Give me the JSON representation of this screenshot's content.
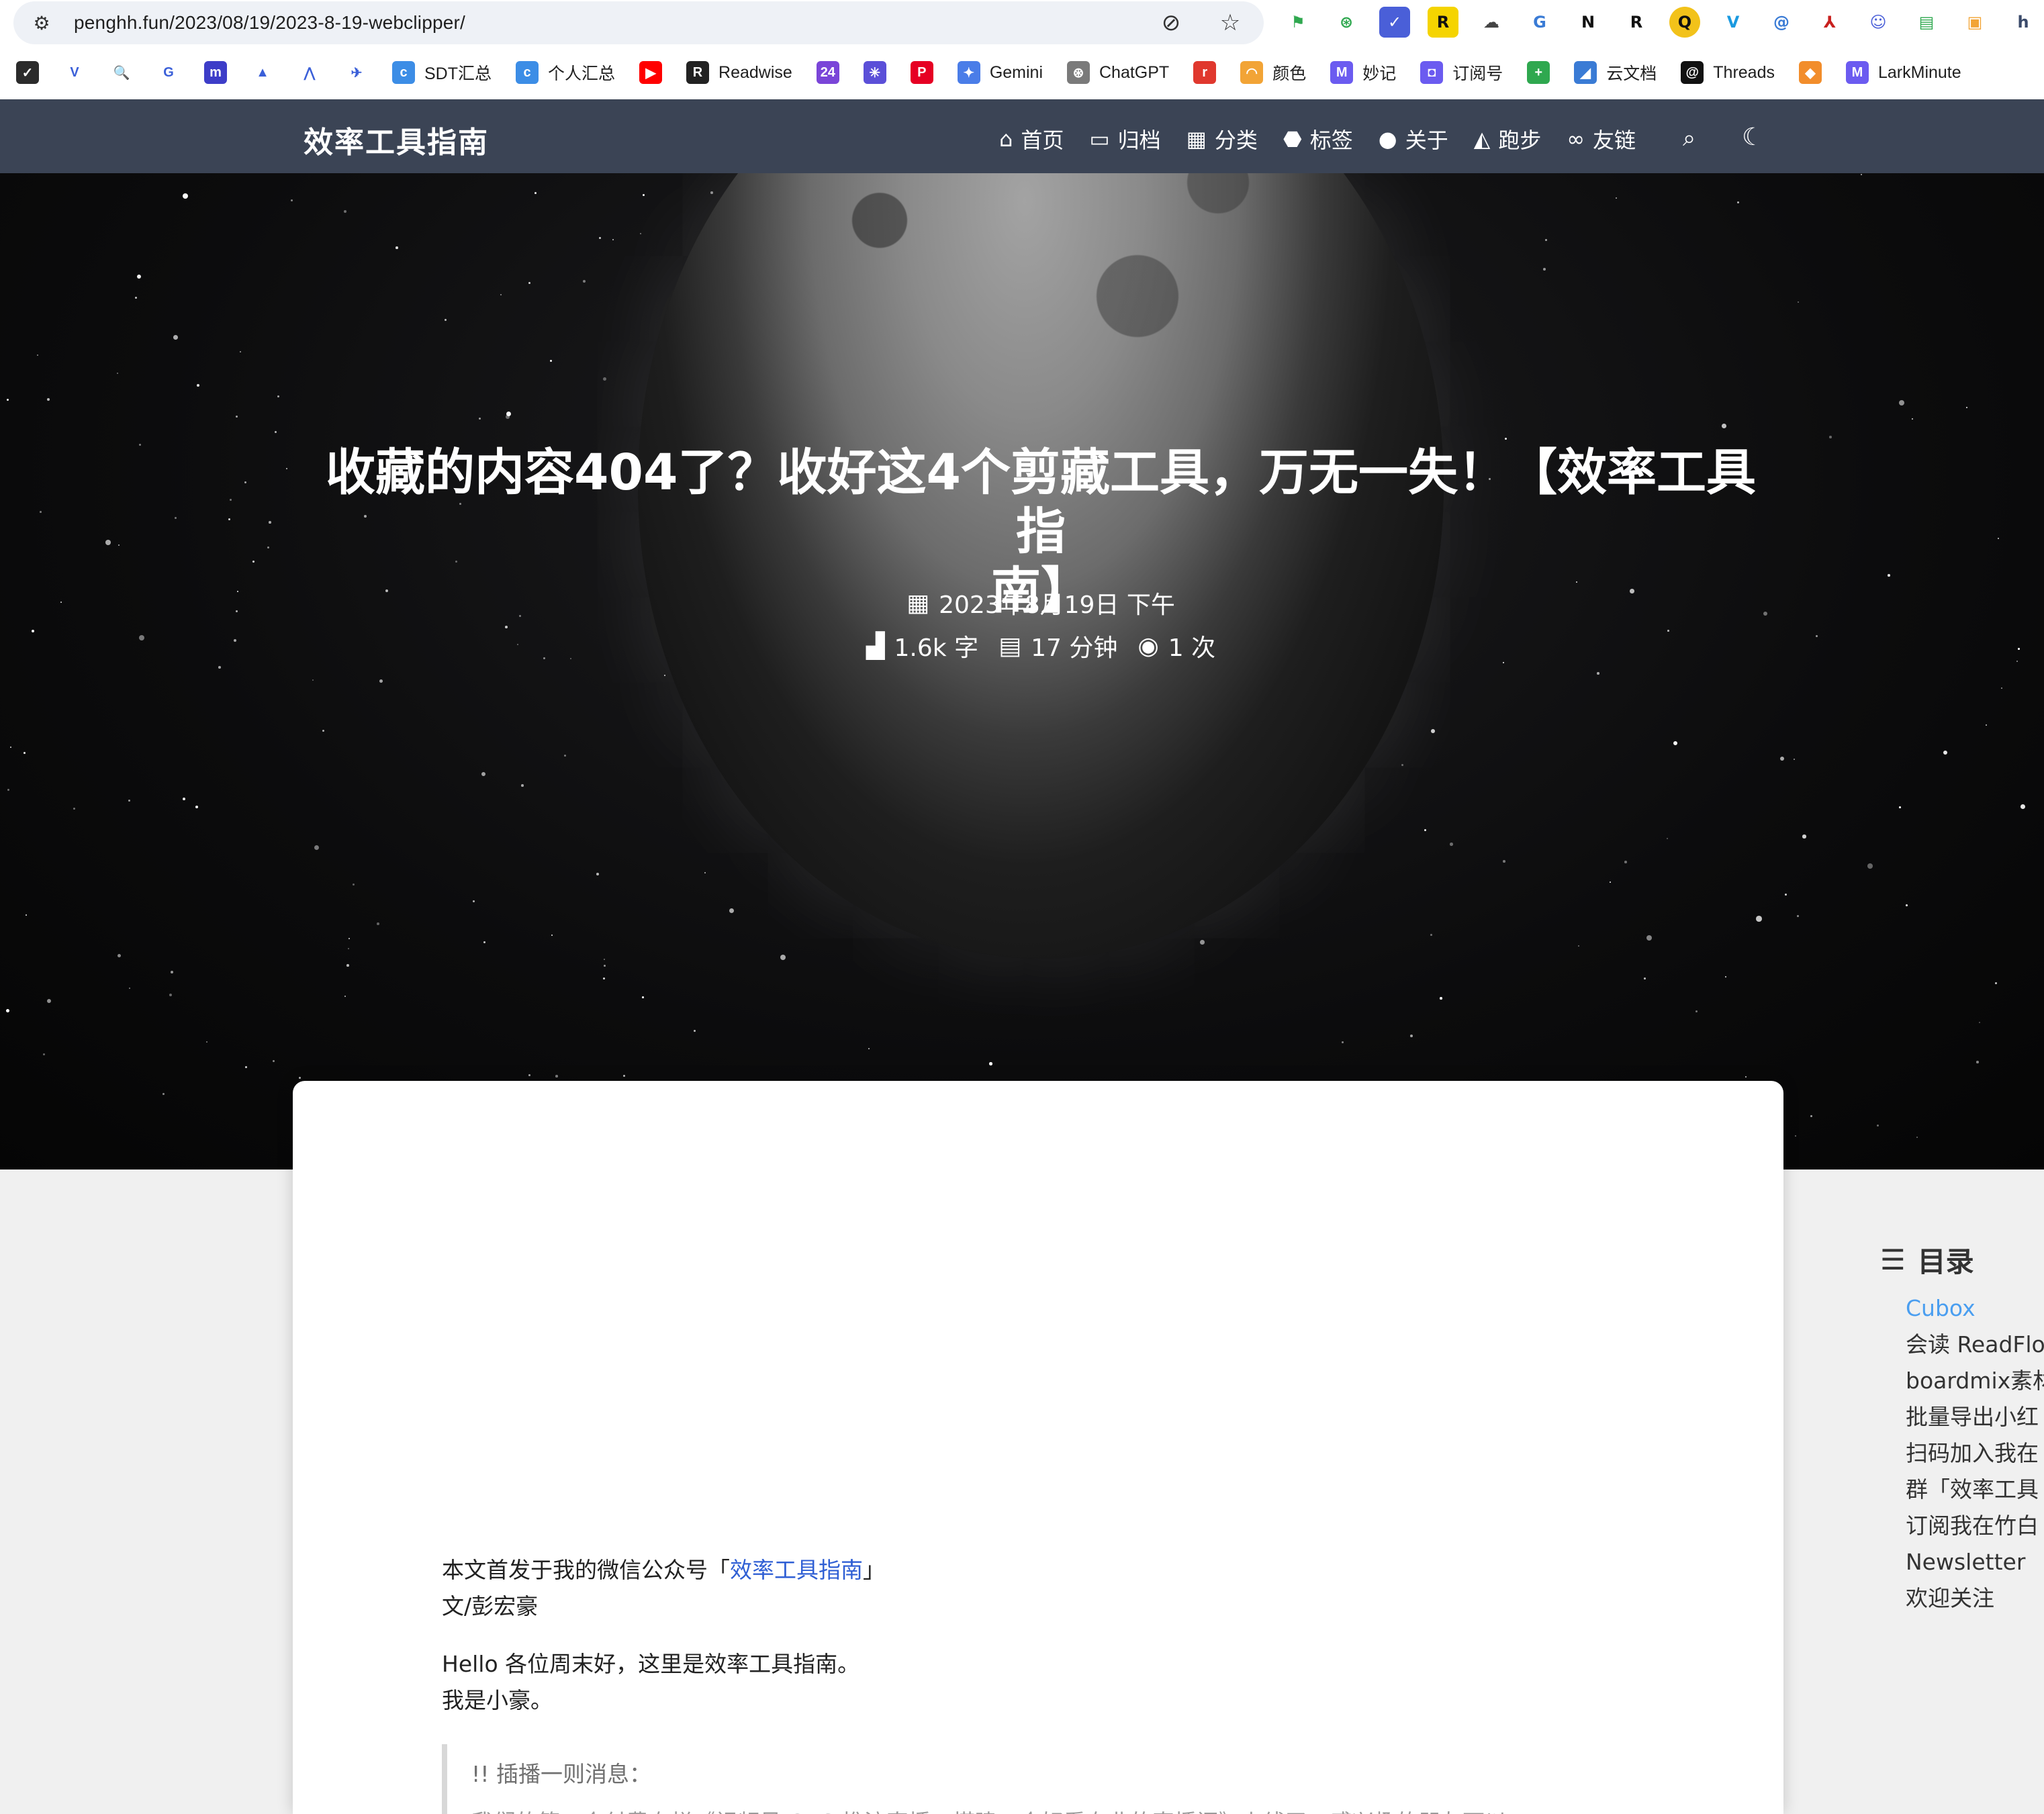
{
  "browser": {
    "url": "penghh.fun/2023/08/19/2023-8-19-webclipper/",
    "bookmarks": [
      {
        "label": "",
        "icon": "ticktick-icon",
        "color": "#2b2b2b",
        "glyph": "✓"
      },
      {
        "label": "",
        "icon": "v-icon",
        "color": "#ffffff",
        "glyph": "V"
      },
      {
        "label": "",
        "icon": "search-icon",
        "color": "#ffffff",
        "glyph": "🔍"
      },
      {
        "label": "",
        "icon": "google-icon",
        "color": "#ffffff",
        "glyph": "G"
      },
      {
        "label": "",
        "icon": "app-icon",
        "color": "#3d3dc8",
        "glyph": "m"
      },
      {
        "label": "",
        "icon": "google-drive-icon",
        "color": "#ffffff",
        "glyph": "▲"
      },
      {
        "label": "",
        "icon": "flow-icon",
        "color": "#ffffff",
        "glyph": "⋀"
      },
      {
        "label": "",
        "icon": "bird-icon",
        "color": "#ffffff",
        "glyph": "✈"
      },
      {
        "label": "SDT汇总",
        "icon": "doc-icon",
        "color": "#3c8de6",
        "glyph": "c"
      },
      {
        "label": "个人汇总",
        "icon": "doc-icon",
        "color": "#3c8de6",
        "glyph": "c"
      },
      {
        "label": "",
        "icon": "youtube-icon",
        "color": "#ff0000",
        "glyph": "▶"
      },
      {
        "label": "Readwise",
        "icon": "readwise-icon",
        "color": "#222222",
        "glyph": "R"
      },
      {
        "label": "",
        "icon": "calendar-24-icon",
        "color": "#7a45d8",
        "glyph": "24"
      },
      {
        "label": "",
        "icon": "app-icon",
        "color": "#5b4fd8",
        "glyph": "✳"
      },
      {
        "label": "",
        "icon": "pinterest-icon",
        "color": "#e60023",
        "glyph": "P"
      },
      {
        "label": "Gemini",
        "icon": "gemini-icon",
        "color": "#4a7de8",
        "glyph": "✦"
      },
      {
        "label": "ChatGPT",
        "icon": "chatgpt-icon",
        "color": "#7a7a7a",
        "glyph": "⊛"
      },
      {
        "label": "",
        "icon": "app-icon",
        "color": "#e0382e",
        "glyph": "r"
      },
      {
        "label": "颜色",
        "icon": "rainbow-icon",
        "color": "#f2a436",
        "glyph": "◠"
      },
      {
        "label": "妙记",
        "icon": "minutes-icon",
        "color": "#6b5bf0",
        "glyph": "M"
      },
      {
        "label": "订阅号",
        "icon": "app-icon",
        "color": "#6b5bf0",
        "glyph": "◘"
      },
      {
        "label": "",
        "icon": "sheets-icon",
        "color": "#2fa84f",
        "glyph": "+"
      },
      {
        "label": "云文档",
        "icon": "cloud-doc-icon",
        "color": "#3a7bd5",
        "glyph": "◢"
      },
      {
        "label": "Threads",
        "icon": "threads-icon",
        "color": "#111111",
        "glyph": "@"
      },
      {
        "label": "",
        "icon": "app-icon",
        "color": "#f28d2b",
        "glyph": "◆"
      },
      {
        "label": "LarkMinute",
        "icon": "lark-icon",
        "color": "#6b5bf0",
        "glyph": "M"
      }
    ]
  },
  "site": {
    "brand": "效率工具指南",
    "nav": [
      {
        "label": "首页",
        "icon": "home-icon",
        "glyph": "⌂"
      },
      {
        "label": "归档",
        "icon": "archive-icon",
        "glyph": "▭"
      },
      {
        "label": "分类",
        "icon": "category-icon",
        "glyph": "▦"
      },
      {
        "label": "标签",
        "icon": "tags-icon",
        "glyph": "⬣"
      },
      {
        "label": "关于",
        "icon": "user-icon",
        "glyph": "●"
      },
      {
        "label": "跑步",
        "icon": "map-icon",
        "glyph": "◭"
      },
      {
        "label": "友链",
        "icon": "link-icon",
        "glyph": "∞"
      }
    ]
  },
  "post": {
    "title_line1": "收藏的内容404了？收好这4个剪藏工具，万无一失！【效率工具指",
    "title_line2": "南】",
    "date": "2023年8月19日 下午",
    "words": "1.6k 字",
    "read_time": "17 分钟",
    "views": "1 次"
  },
  "article": {
    "intro_prefix": "本文首发于我的微信公众号「",
    "intro_link": "效率工具指南",
    "intro_suffix": "」",
    "author": "文/彭宏豪",
    "hello": "Hello 各位周末好，这里是效率工具指南。",
    "me": "我是小豪。",
    "quote_title": "!! 插播一则消息：",
    "quote_text": "我们的第一个付费专栏《视频号 OBS 推流直播，搭建一个好看专业的直播间》上线了，感兴趣的朋友可以"
  },
  "toc": {
    "title": "目录",
    "items": [
      {
        "label": "Cubox",
        "active": true
      },
      {
        "label": "会读 ReadFlo",
        "active": false
      },
      {
        "label": "boardmix素材",
        "active": false
      },
      {
        "label": "批量导出小红",
        "active": false
      },
      {
        "label": "扫码加入我在",
        "active": false
      },
      {
        "label": "群「效率工具",
        "active": false
      },
      {
        "label": "订阅我在竹白",
        "active": false
      },
      {
        "label": "Newsletter",
        "active": false
      },
      {
        "label": "欢迎关注",
        "active": false
      }
    ]
  }
}
